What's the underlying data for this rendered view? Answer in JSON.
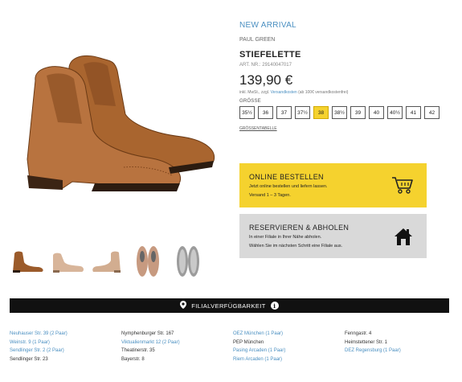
{
  "product": {
    "badge": "NEW ARRIVAL",
    "brand": "PAUL GREEN",
    "title": "STIEFELETTE",
    "article": "ART. NR.: 29140047017",
    "price": "139,90 €",
    "shipping_prefix": "inkl. MwSt., zzgl.",
    "shipping_link": "Versandkosten",
    "shipping_note": "(ab 100€ versandkostenfrei)",
    "size_label": "GRÖSSE",
    "sizes": [
      {
        "label": "35½",
        "selected": false
      },
      {
        "label": "36",
        "selected": false
      },
      {
        "label": "37",
        "selected": false
      },
      {
        "label": "37½",
        "selected": false
      },
      {
        "label": "38",
        "selected": true
      },
      {
        "label": "38½",
        "selected": false
      },
      {
        "label": "39",
        "selected": false
      },
      {
        "label": "40",
        "selected": false
      },
      {
        "label": "40½",
        "selected": false
      },
      {
        "label": "41",
        "selected": false
      },
      {
        "label": "42",
        "selected": false
      }
    ],
    "size_table_link": "GRÖSSENTABELLE",
    "main_color": "#b8733f"
  },
  "online": {
    "title": "ONLINE BESTELLEN",
    "line1": "Jetzt online bestellen und liefern lassen.",
    "line2": "Versand 1 – 3 Tagen.",
    "icon": "shopping-cart-icon",
    "color": "#f5d22e"
  },
  "reserve": {
    "title": "RESERVIEREN & ABHOLEN",
    "line1": "In einer Filiale in Ihrer Nähe abholen.",
    "line2": "Wählen Sie im nächsten Schritt eine Filiale aus.",
    "icon": "house-icon",
    "color": "#d9d9d9"
  },
  "availability": {
    "label": "FILIALVERFÜGBARKEIT",
    "info": "i"
  },
  "stores": {
    "col1": [
      {
        "name": "Neuhauser Str. 39 (2 Paar)",
        "linked": true
      },
      {
        "name": "Weinstr. 9 (1 Paar)",
        "linked": true
      },
      {
        "name": "Sendlinger Str. 2 (2 Paar)",
        "linked": true
      },
      {
        "name": "Sendlinger Str. 23",
        "linked": false
      }
    ],
    "col2": [
      {
        "name": "Nymphenburger Str. 167",
        "linked": false
      },
      {
        "name": "Viktualienmarkt 12 (2 Paar)",
        "linked": true
      },
      {
        "name": "Theatinerstr. 35",
        "linked": false
      },
      {
        "name": "Bayerstr. 8",
        "linked": false
      }
    ],
    "col3": [
      {
        "name": "OEZ München (1 Paar)",
        "linked": true
      },
      {
        "name": "PEP München",
        "linked": false
      },
      {
        "name": "Pasing Arcaden (1 Paar)",
        "linked": true
      },
      {
        "name": "Riem Arcaden (1 Paar)",
        "linked": true
      }
    ],
    "col4": [
      {
        "name": "Fenngastr. 4",
        "linked": false
      },
      {
        "name": "Heimstettener Str. 1",
        "linked": false
      },
      {
        "name": "DEZ Regensburg (1 Paar)",
        "linked": true
      }
    ]
  },
  "thumbnails": [
    "side-view",
    "side-view-light",
    "side-view-light-2",
    "sole-top-view",
    "insole-view"
  ]
}
